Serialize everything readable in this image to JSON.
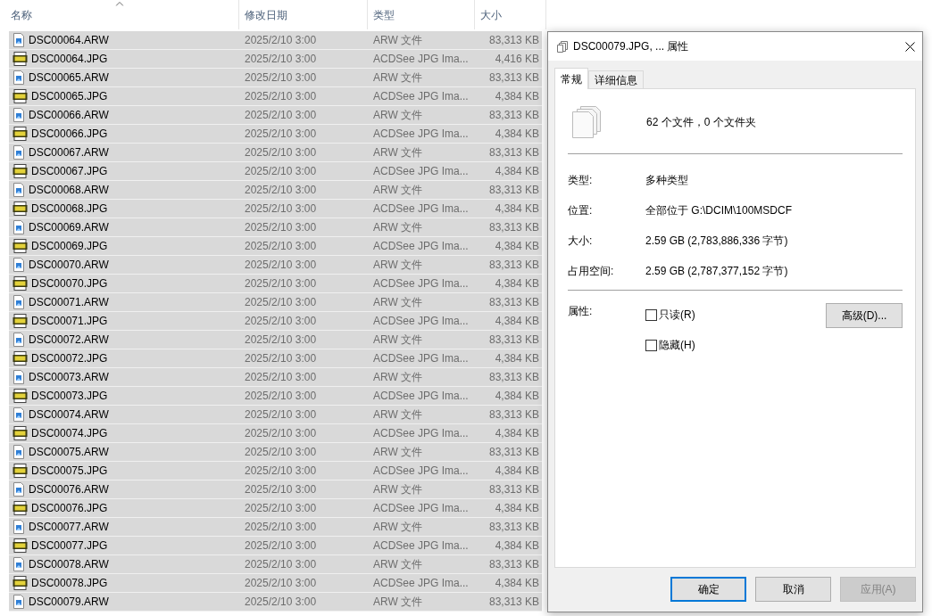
{
  "file_list": {
    "columns": [
      {
        "label": "名称",
        "sorted": true
      },
      {
        "label": "修改日期",
        "sorted": false
      },
      {
        "label": "类型",
        "sorted": false
      },
      {
        "label": "大小",
        "sorted": false
      }
    ],
    "rows": [
      {
        "kind": "arw",
        "name": "DSC00064.ARW",
        "date": "2025/2/10 3:00",
        "type": "ARW 文件",
        "size": "83,313 KB",
        "selected": true
      },
      {
        "kind": "jpg",
        "name": "DSC00064.JPG",
        "date": "2025/2/10 3:00",
        "type": "ACDSee JPG Ima...",
        "size": "4,416 KB",
        "selected": true
      },
      {
        "kind": "arw",
        "name": "DSC00065.ARW",
        "date": "2025/2/10 3:00",
        "type": "ARW 文件",
        "size": "83,313 KB",
        "selected": true
      },
      {
        "kind": "jpg",
        "name": "DSC00065.JPG",
        "date": "2025/2/10 3:00",
        "type": "ACDSee JPG Ima...",
        "size": "4,384 KB",
        "selected": true
      },
      {
        "kind": "arw",
        "name": "DSC00066.ARW",
        "date": "2025/2/10 3:00",
        "type": "ARW 文件",
        "size": "83,313 KB",
        "selected": true
      },
      {
        "kind": "jpg",
        "name": "DSC00066.JPG",
        "date": "2025/2/10 3:00",
        "type": "ACDSee JPG Ima...",
        "size": "4,384 KB",
        "selected": true
      },
      {
        "kind": "arw",
        "name": "DSC00067.ARW",
        "date": "2025/2/10 3:00",
        "type": "ARW 文件",
        "size": "83,313 KB",
        "selected": true
      },
      {
        "kind": "jpg",
        "name": "DSC00067.JPG",
        "date": "2025/2/10 3:00",
        "type": "ACDSee JPG Ima...",
        "size": "4,384 KB",
        "selected": true
      },
      {
        "kind": "arw",
        "name": "DSC00068.ARW",
        "date": "2025/2/10 3:00",
        "type": "ARW 文件",
        "size": "83,313 KB",
        "selected": true
      },
      {
        "kind": "jpg",
        "name": "DSC00068.JPG",
        "date": "2025/2/10 3:00",
        "type": "ACDSee JPG Ima...",
        "size": "4,384 KB",
        "selected": true
      },
      {
        "kind": "arw",
        "name": "DSC00069.ARW",
        "date": "2025/2/10 3:00",
        "type": "ARW 文件",
        "size": "83,313 KB",
        "selected": true
      },
      {
        "kind": "jpg",
        "name": "DSC00069.JPG",
        "date": "2025/2/10 3:00",
        "type": "ACDSee JPG Ima...",
        "size": "4,384 KB",
        "selected": true
      },
      {
        "kind": "arw",
        "name": "DSC00070.ARW",
        "date": "2025/2/10 3:00",
        "type": "ARW 文件",
        "size": "83,313 KB",
        "selected": true
      },
      {
        "kind": "jpg",
        "name": "DSC00070.JPG",
        "date": "2025/2/10 3:00",
        "type": "ACDSee JPG Ima...",
        "size": "4,384 KB",
        "selected": true
      },
      {
        "kind": "arw",
        "name": "DSC00071.ARW",
        "date": "2025/2/10 3:00",
        "type": "ARW 文件",
        "size": "83,313 KB",
        "selected": true
      },
      {
        "kind": "jpg",
        "name": "DSC00071.JPG",
        "date": "2025/2/10 3:00",
        "type": "ACDSee JPG Ima...",
        "size": "4,384 KB",
        "selected": true
      },
      {
        "kind": "arw",
        "name": "DSC00072.ARW",
        "date": "2025/2/10 3:00",
        "type": "ARW 文件",
        "size": "83,313 KB",
        "selected": true
      },
      {
        "kind": "jpg",
        "name": "DSC00072.JPG",
        "date": "2025/2/10 3:00",
        "type": "ACDSee JPG Ima...",
        "size": "4,384 KB",
        "selected": true
      },
      {
        "kind": "arw",
        "name": "DSC00073.ARW",
        "date": "2025/2/10 3:00",
        "type": "ARW 文件",
        "size": "83,313 KB",
        "selected": true
      },
      {
        "kind": "jpg",
        "name": "DSC00073.JPG",
        "date": "2025/2/10 3:00",
        "type": "ACDSee JPG Ima...",
        "size": "4,384 KB",
        "selected": true
      },
      {
        "kind": "arw",
        "name": "DSC00074.ARW",
        "date": "2025/2/10 3:00",
        "type": "ARW 文件",
        "size": "83,313 KB",
        "selected": true
      },
      {
        "kind": "jpg",
        "name": "DSC00074.JPG",
        "date": "2025/2/10 3:00",
        "type": "ACDSee JPG Ima...",
        "size": "4,384 KB",
        "selected": true
      },
      {
        "kind": "arw",
        "name": "DSC00075.ARW",
        "date": "2025/2/10 3:00",
        "type": "ARW 文件",
        "size": "83,313 KB",
        "selected": true
      },
      {
        "kind": "jpg",
        "name": "DSC00075.JPG",
        "date": "2025/2/10 3:00",
        "type": "ACDSee JPG Ima...",
        "size": "4,384 KB",
        "selected": true
      },
      {
        "kind": "arw",
        "name": "DSC00076.ARW",
        "date": "2025/2/10 3:00",
        "type": "ARW 文件",
        "size": "83,313 KB",
        "selected": true
      },
      {
        "kind": "jpg",
        "name": "DSC00076.JPG",
        "date": "2025/2/10 3:00",
        "type": "ACDSee JPG Ima...",
        "size": "4,384 KB",
        "selected": true
      },
      {
        "kind": "arw",
        "name": "DSC00077.ARW",
        "date": "2025/2/10 3:00",
        "type": "ARW 文件",
        "size": "83,313 KB",
        "selected": true
      },
      {
        "kind": "jpg",
        "name": "DSC00077.JPG",
        "date": "2025/2/10 3:00",
        "type": "ACDSee JPG Ima...",
        "size": "4,384 KB",
        "selected": true
      },
      {
        "kind": "arw",
        "name": "DSC00078.ARW",
        "date": "2025/2/10 3:00",
        "type": "ARW 文件",
        "size": "83,313 KB",
        "selected": true
      },
      {
        "kind": "jpg",
        "name": "DSC00078.JPG",
        "date": "2025/2/10 3:00",
        "type": "ACDSee JPG Ima...",
        "size": "4,384 KB",
        "selected": true
      },
      {
        "kind": "arw",
        "name": "DSC00079.ARW",
        "date": "2025/2/10 3:00",
        "type": "ARW 文件",
        "size": "83,313 KB",
        "selected": true
      }
    ]
  },
  "dialog": {
    "title": "DSC00079.JPG, ... 属性",
    "tabs": [
      {
        "label": "常规",
        "selected": true
      },
      {
        "label": "详细信息",
        "selected": false
      }
    ],
    "summary": "62 个文件，0 个文件夹",
    "fields": [
      {
        "label": "类型:",
        "value": "多种类型"
      },
      {
        "label": "位置:",
        "value": "全部位于 G:\\DCIM\\100MSDCF"
      },
      {
        "label": "大小:",
        "value": "2.59 GB (2,783,886,336 字节)"
      },
      {
        "label": "占用空间:",
        "value": "2.59 GB (2,787,377,152 字节)"
      }
    ],
    "attributes_label": "属性:",
    "attributes": [
      {
        "label": "只读(R)",
        "checked": false
      },
      {
        "label": "隐藏(H)",
        "checked": false
      }
    ],
    "advanced_button": "高级(D)...",
    "buttons": [
      {
        "label": "确定",
        "default": true,
        "disabled": false
      },
      {
        "label": "取消",
        "default": false,
        "disabled": false
      },
      {
        "label": "应用(A)",
        "default": false,
        "disabled": true
      }
    ]
  }
}
